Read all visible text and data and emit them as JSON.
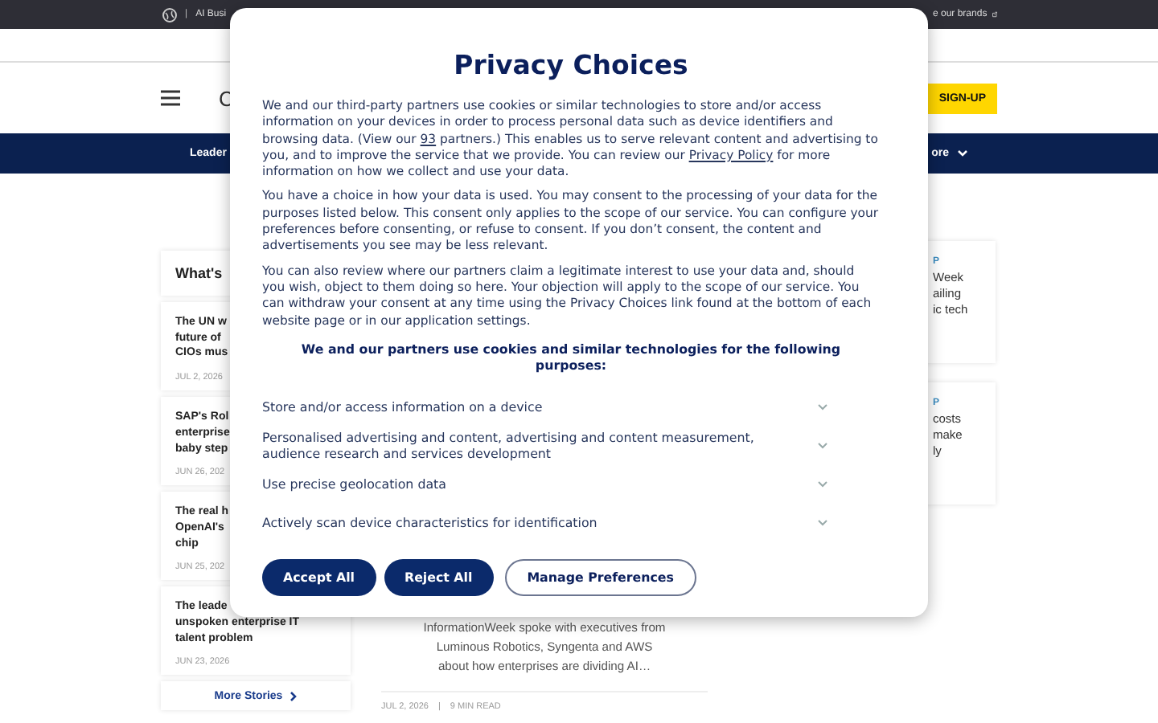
{
  "top_bar": {
    "left_text": "AI Busi",
    "separator": "|",
    "right_text": "e our brands"
  },
  "header": {
    "logo_fragment": "C",
    "signup_button": "SIGN-UP"
  },
  "nav": {
    "left_item": "Leader",
    "right_item": "ore"
  },
  "sidebar": {
    "title": "What's",
    "stories": [
      {
        "title_lines": [
          "The UN w",
          "future of",
          "CIOs mus"
        ],
        "date": "JUL 2, 2026"
      },
      {
        "title_lines": [
          "SAP's Rol",
          "enterprise",
          "baby step"
        ],
        "date": "JUN 26, 202"
      },
      {
        "title_lines": [
          "The real h",
          "OpenAI's",
          "chip"
        ],
        "date": "JUN 25, 202"
      },
      {
        "title_lines": [
          "The leade",
          "unspoken enterprise IT",
          "talent problem"
        ],
        "date": "JUN 23, 2026"
      }
    ],
    "more_button": "More Stories"
  },
  "article": {
    "summary": "InformationWeek spoke with executives from Luminous Robotics, Syngenta and AWS about how enterprises are dividing AI…",
    "date": "JUL 2, 2026",
    "separator": "|",
    "read_time": "9 MIN READ"
  },
  "right_cards": [
    {
      "tag": "P",
      "title_lines": [
        "Week",
        "ailing",
        "ic tech"
      ]
    },
    {
      "tag": "P",
      "title_lines": [
        "costs",
        "make",
        "ly"
      ]
    }
  ],
  "dialog": {
    "title": "Privacy Choices",
    "paragraphs": [
      [
        {
          "text": "We and our third-party partners use cookies or similar technologies to store and/or access information on your devices in order to process personal data such as device identifiers and browsing data. (View our "
        },
        {
          "link": "93"
        },
        {
          "text": " partners.) This enables us to serve relevant content and advertising to you, and to improve the service that we provide. You can review our "
        },
        {
          "link": "Privacy Policy"
        },
        {
          "text": " for more information on how we collect and use your data."
        }
      ],
      [
        {
          "text": "You have a choice in how your data is used. You may consent to the processing of your data for the purposes listed below. This consent only applies to the scope of our service. You can configure your preferences before consenting, or refuse to consent. If you don’t consent, the content and advertisements you see may be less relevant."
        }
      ],
      [
        {
          "text": "You can also review where our partners claim a legitimate interest to use your data and, should you wish, object to them doing so here. Your objection will apply to the scope of our service. You can withdraw your consent at any time using the Privacy Choices link found at the bottom of each website page or in our application settings."
        }
      ]
    ],
    "purposes_heading": "We and our partners use cookies and similar technologies for the following purposes:",
    "purposes": [
      {
        "label": "Store and/or access information on a device",
        "expanded": false
      },
      {
        "label": "Personalised advertising and content, advertising and content measurement, audience research and services development",
        "expanded": false
      },
      {
        "label": "Use precise geolocation data",
        "expanded": false
      },
      {
        "label": "Actively scan device characteristics for identification",
        "expanded": false
      }
    ],
    "buttons": [
      {
        "label": "Accept All",
        "kind": "primary"
      },
      {
        "label": "Reject All",
        "kind": "primary"
      },
      {
        "label": "Manage Preferences",
        "kind": "outline"
      }
    ]
  }
}
